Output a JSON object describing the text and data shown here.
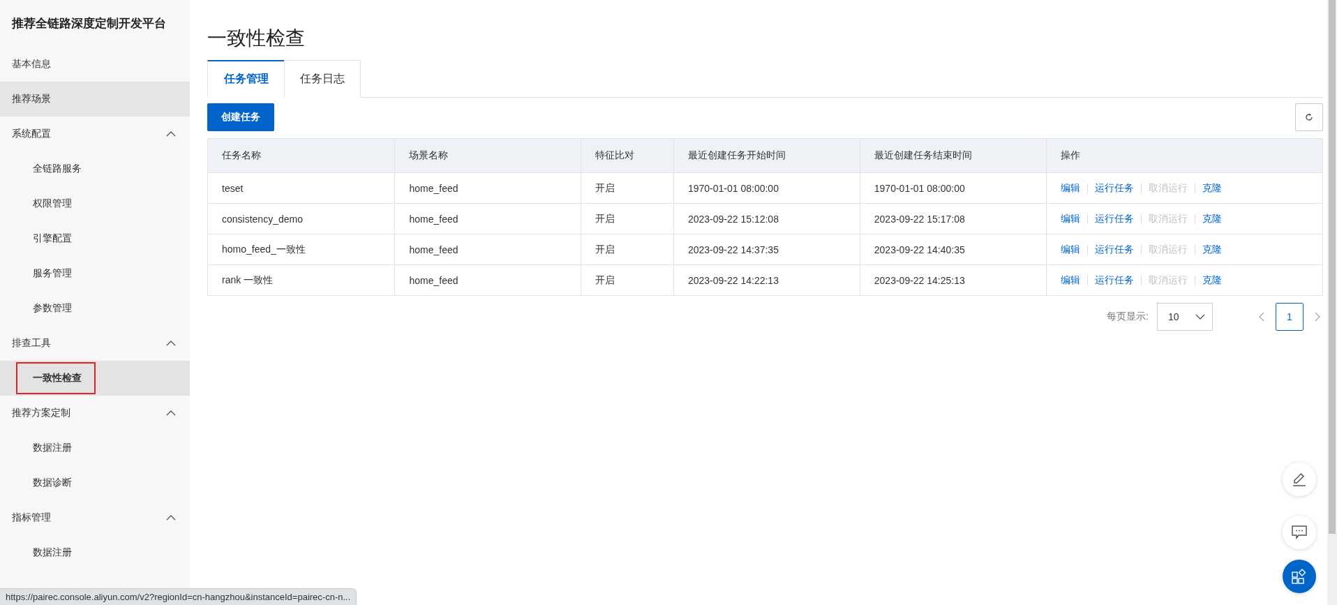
{
  "sidebar": {
    "title": "推荐全链路深度定制开发平台",
    "items": [
      {
        "kind": "item",
        "label": "基本信息",
        "hovered": false
      },
      {
        "kind": "item",
        "label": "推荐场景",
        "hovered": true
      },
      {
        "kind": "group",
        "label": "系统配置",
        "expanded": true,
        "children": [
          {
            "label": "全链路服务",
            "selected": false,
            "annotated": false
          },
          {
            "label": "权限管理",
            "selected": false,
            "annotated": false
          },
          {
            "label": "引擎配置",
            "selected": false,
            "annotated": false
          },
          {
            "label": "服务管理",
            "selected": false,
            "annotated": false
          },
          {
            "label": "参数管理",
            "selected": false,
            "annotated": false
          }
        ]
      },
      {
        "kind": "group",
        "label": "排查工具",
        "expanded": true,
        "children": [
          {
            "label": "一致性检查",
            "selected": true,
            "annotated": true
          }
        ]
      },
      {
        "kind": "group",
        "label": "推荐方案定制",
        "expanded": true,
        "children": [
          {
            "label": "数据注册",
            "selected": false,
            "annotated": false
          },
          {
            "label": "数据诊断",
            "selected": false,
            "annotated": false
          }
        ]
      },
      {
        "kind": "group",
        "label": "指标管理",
        "expanded": true,
        "children": [
          {
            "label": "数据注册",
            "selected": false,
            "annotated": false
          }
        ]
      }
    ]
  },
  "page_title": "一致性检查",
  "tabs": [
    {
      "label": "任务管理",
      "selected": true
    },
    {
      "label": "任务日志",
      "selected": false
    }
  ],
  "create_button": "创建任务",
  "table": {
    "columns": [
      "任务名称",
      "场景名称",
      "特征比对",
      "最近创建任务开始时间",
      "最近创建任务结束时间",
      "操作"
    ],
    "rows": [
      {
        "cells": [
          "teset",
          "home_feed",
          "开启",
          "1970-01-01 08:00:00",
          "1970-01-01 08:00:00"
        ],
        "actions": [
          {
            "label": "编辑",
            "disabled": false
          },
          {
            "label": "运行任务",
            "disabled": false
          },
          {
            "label": "取消运行",
            "disabled": true
          },
          {
            "label": "克隆",
            "disabled": false
          }
        ]
      },
      {
        "cells": [
          "consistency_demo",
          "home_feed",
          "开启",
          "2023-09-22 15:12:08",
          "2023-09-22 15:17:08"
        ],
        "actions": [
          {
            "label": "编辑",
            "disabled": false
          },
          {
            "label": "运行任务",
            "disabled": false
          },
          {
            "label": "取消运行",
            "disabled": true
          },
          {
            "label": "克隆",
            "disabled": false
          }
        ]
      },
      {
        "cells": [
          "homo_feed_一致性",
          "home_feed",
          "开启",
          "2023-09-22 14:37:35",
          "2023-09-22 14:40:35"
        ],
        "actions": [
          {
            "label": "编辑",
            "disabled": false
          },
          {
            "label": "运行任务",
            "disabled": false
          },
          {
            "label": "取消运行",
            "disabled": true
          },
          {
            "label": "克隆",
            "disabled": false
          }
        ]
      },
      {
        "cells": [
          "rank 一致性",
          "home_feed",
          "开启",
          "2023-09-22 14:22:13",
          "2023-09-22 14:25:13"
        ],
        "actions": [
          {
            "label": "编辑",
            "disabled": false
          },
          {
            "label": "运行任务",
            "disabled": false
          },
          {
            "label": "取消运行",
            "disabled": true
          },
          {
            "label": "克隆",
            "disabled": false
          }
        ]
      }
    ]
  },
  "pagination": {
    "page_size_label": "每页显示:",
    "page_size": "10",
    "pages": [
      {
        "label": "1",
        "selected": true
      }
    ]
  },
  "status_bar": {
    "url": "https://pairec.console.aliyun.com/v2?regionId=cn-hangzhou&instanceId=pairec-cn-n..."
  }
}
